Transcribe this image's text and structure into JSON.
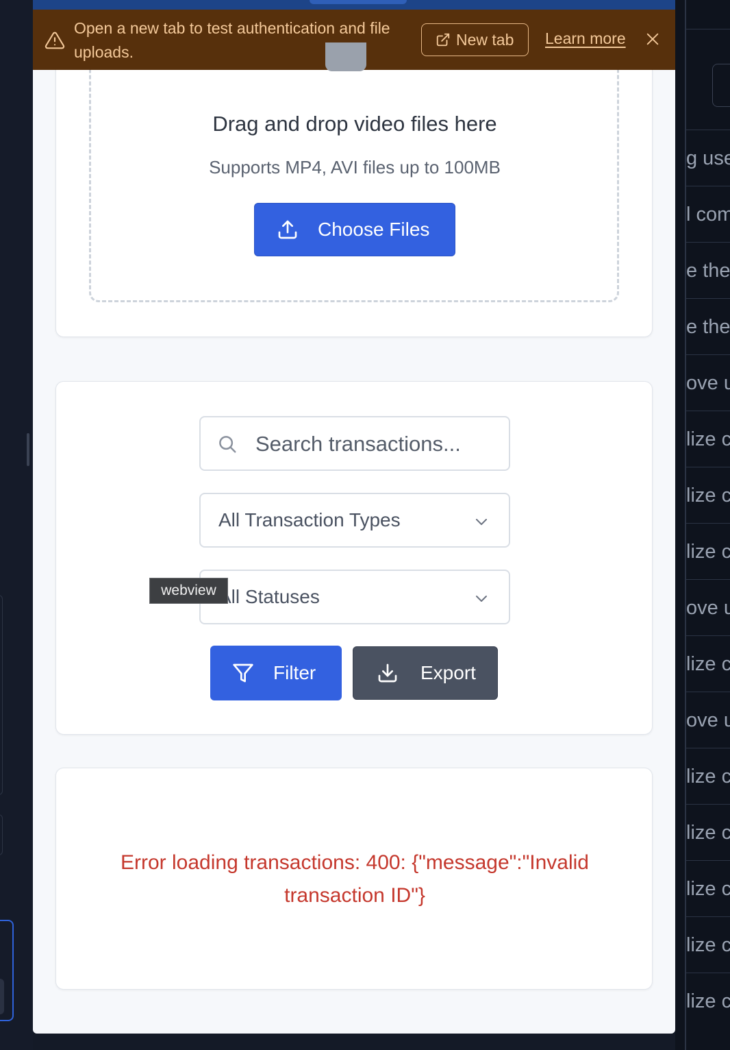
{
  "banner": {
    "message": "Open a new tab to test authentication and file uploads.",
    "new_tab_label": "New tab",
    "learn_more_label": "Learn more"
  },
  "upload": {
    "title": "Drag and drop video files here",
    "subtitle": "Supports MP4, AVI files up to 100MB",
    "choose_label": "Choose Files"
  },
  "filters": {
    "search_placeholder": "Search transactions...",
    "type_select": "All Transaction Types",
    "status_select": "All Statuses",
    "filter_label": "Filter",
    "export_label": "Export"
  },
  "tooltip": "webview",
  "error": {
    "message": "Error loading transactions: 400: {\"message\":\"Invalid transaction ID\"}"
  },
  "background_rows": [
    "g use",
    "l com",
    "e the",
    "e the",
    "ove u",
    "lize c",
    "lize c",
    "lize c",
    "ove u",
    "lize c",
    "ove u",
    "lize c",
    "lize c",
    "lize c",
    "lize c",
    "lize c"
  ],
  "colors": {
    "primary": "#3361e0",
    "secondary": "#4a5261",
    "banner_bg": "#57300c",
    "error": "#c5382d"
  }
}
